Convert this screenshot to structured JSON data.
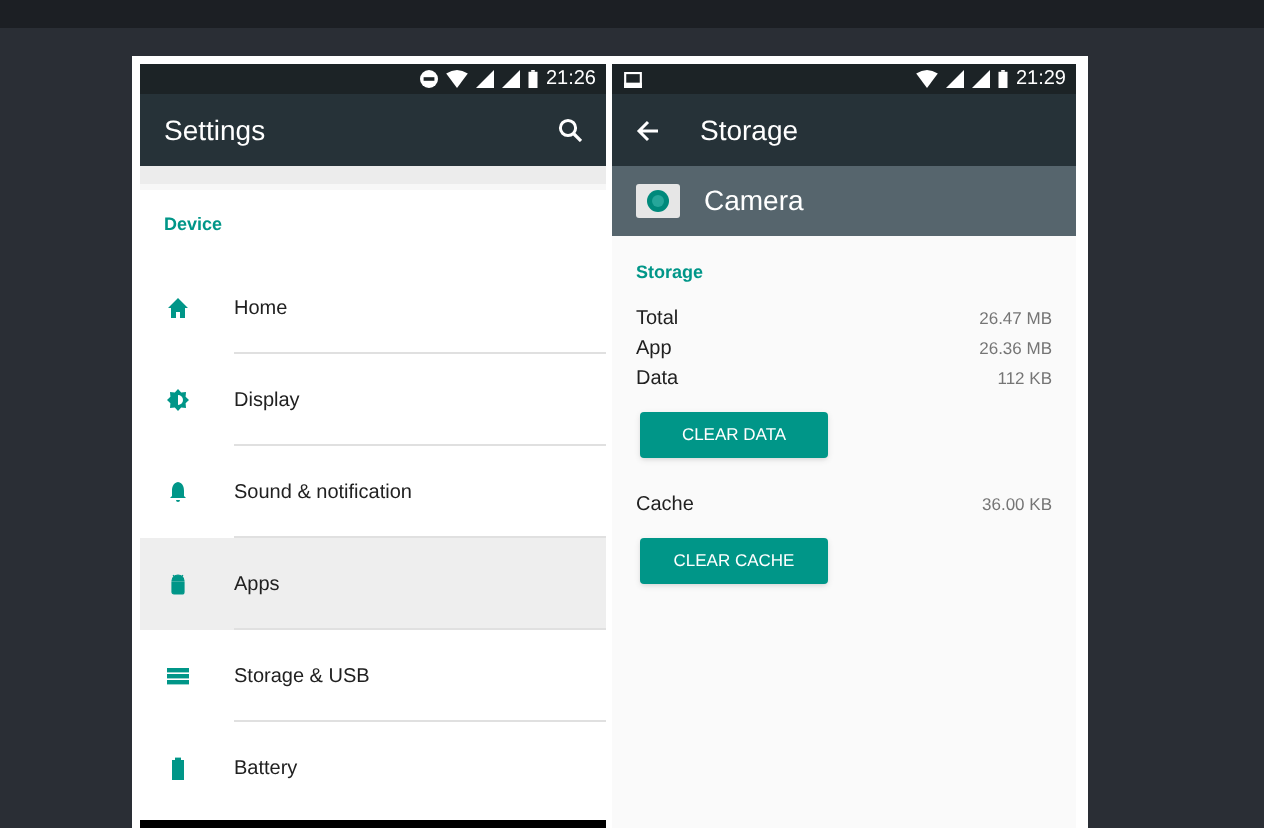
{
  "settings_screen": {
    "status_bar": {
      "time": "21:26"
    },
    "app_bar": {
      "title": "Settings"
    },
    "section_header": "Device",
    "items": [
      {
        "kind": "home",
        "label": "Home",
        "selected": false
      },
      {
        "kind": "display",
        "label": "Display",
        "selected": false
      },
      {
        "kind": "bell",
        "label": "Sound & notification",
        "selected": false
      },
      {
        "kind": "android",
        "label": "Apps",
        "selected": true
      },
      {
        "kind": "storage",
        "label": "Storage & USB",
        "selected": false
      },
      {
        "kind": "battery",
        "label": "Battery",
        "selected": false
      }
    ]
  },
  "storage_screen": {
    "status_bar": {
      "time": "21:29"
    },
    "app_bar": {
      "title": "Storage"
    },
    "app_header": {
      "name": "Camera"
    },
    "section_header": "Storage",
    "rows": [
      {
        "label": "Total",
        "value": "26.47 MB"
      },
      {
        "label": "App",
        "value": "26.36 MB"
      },
      {
        "label": "Data",
        "value": "112 KB"
      }
    ],
    "clear_data_button": "CLEAR DATA",
    "cache": {
      "label": "Cache",
      "value": "36.00 KB"
    },
    "clear_cache_button": "CLEAR CACHE"
  }
}
